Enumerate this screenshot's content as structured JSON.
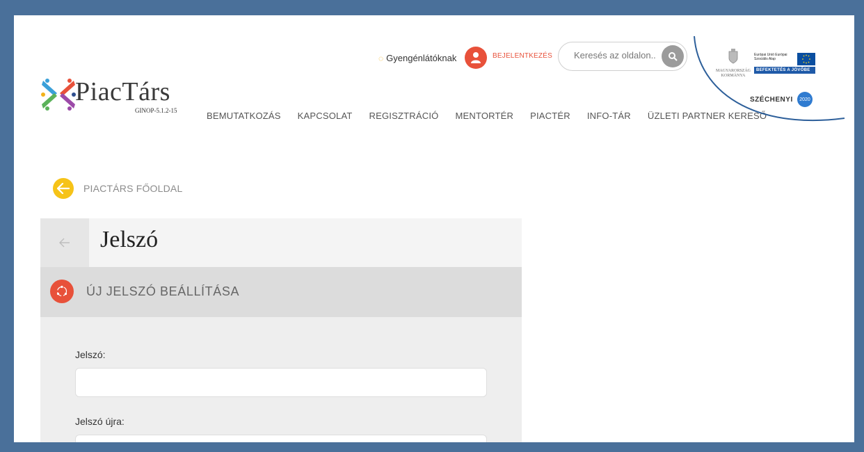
{
  "header": {
    "logo": {
      "name": "PiacTárs",
      "subtitle": "GINOP-5.1.2-15"
    },
    "accessibility_label": "Gyengénlátóknak",
    "login_label": "BEJELENTKEZÉS",
    "search": {
      "placeholder": "Keresés az oldalon..."
    },
    "nav": [
      {
        "label": "BEMUTATKOZÁS"
      },
      {
        "label": "KAPCSOLAT"
      },
      {
        "label": "REGISZTRÁCIÓ"
      },
      {
        "label": "MENTORTÉR"
      },
      {
        "label": "PIACTÉR"
      },
      {
        "label": "INFO-TÁR"
      },
      {
        "label": "ÜZLETI PARTNER KERESŐ"
      }
    ],
    "partners": {
      "hu_gov": "MAGYARORSZÁG KORMÁNYA",
      "eu_text": "Európai Unió Európai Szociális Alap",
      "eu_band": "BEFEKTETÉS A JÖVŐBE",
      "szechenyi": "SZÉCHENYI",
      "szechenyi_badge": "2020"
    }
  },
  "breadcrumb": {
    "back_label": "PIACTÁRS FŐOLDAL"
  },
  "panel": {
    "title": "Jelszó",
    "section_title": "ÚJ JELSZÓ BEÁLLÍTÁSA",
    "fields": [
      {
        "label": "Jelszó:",
        "value": ""
      },
      {
        "label": "Jelszó újra:",
        "value": ""
      }
    ]
  },
  "colors": {
    "accent": "#e8513a",
    "back_icon": "#f6c318",
    "frame_border": "#4a709a",
    "arc": "#2d5f9a"
  }
}
